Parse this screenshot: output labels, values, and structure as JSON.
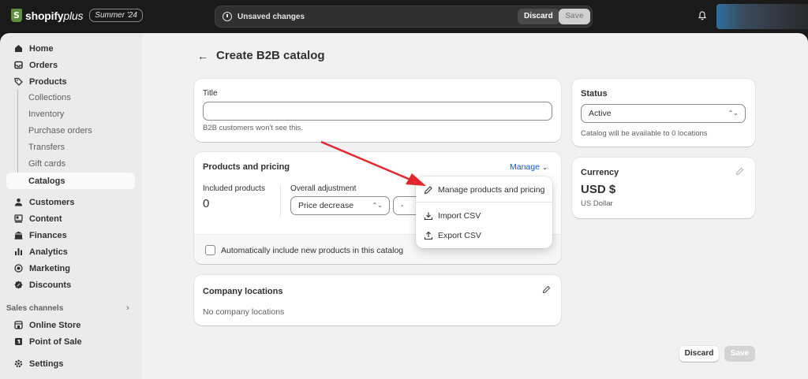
{
  "topbar": {
    "brand": "shopify",
    "brand_plus": "plus",
    "edition": "Summer '24",
    "unsaved_text": "Unsaved changes",
    "discard_label": "Discard",
    "save_label": "Save"
  },
  "sidebar": {
    "items": [
      {
        "label": "Home",
        "icon": "home-icon"
      },
      {
        "label": "Orders",
        "icon": "inbox-icon"
      },
      {
        "label": "Products",
        "icon": "tag-icon"
      },
      {
        "label": "Customers",
        "icon": "person-icon"
      },
      {
        "label": "Content",
        "icon": "content-icon"
      },
      {
        "label": "Finances",
        "icon": "bank-icon"
      },
      {
        "label": "Analytics",
        "icon": "bar-chart-icon"
      },
      {
        "label": "Marketing",
        "icon": "target-icon"
      },
      {
        "label": "Discounts",
        "icon": "discount-icon"
      }
    ],
    "product_subitems": [
      "Collections",
      "Inventory",
      "Purchase orders",
      "Transfers",
      "Gift cards",
      "Catalogs"
    ],
    "sales_channels_label": "Sales channels",
    "channels": [
      {
        "label": "Online Store",
        "icon": "store-icon"
      },
      {
        "label": "Point of Sale",
        "icon": "pos-icon"
      }
    ],
    "settings_label": "Settings"
  },
  "page": {
    "back_icon": "arrow-left-icon",
    "title": "Create B2B catalog"
  },
  "title_card": {
    "label": "Title",
    "value": "",
    "help": "B2B customers won't see this."
  },
  "products_card": {
    "title": "Products and pricing",
    "manage_label": "Manage",
    "included_label": "Included products",
    "included_value": "0",
    "adjustment_label": "Overall adjustment",
    "adjustment_type": "Price decrease",
    "adjustment_value": "-",
    "auto_include_label": "Automatically include new products in this catalog",
    "auto_include_checked": false
  },
  "manage_menu": {
    "items": [
      {
        "label": "Manage products and pricing",
        "icon": "pencil-icon"
      },
      {
        "label": "Import CSV",
        "icon": "download-icon"
      },
      {
        "label": "Export CSV",
        "icon": "upload-icon"
      }
    ]
  },
  "locations_card": {
    "title": "Company locations",
    "empty_text": "No company locations"
  },
  "status_card": {
    "title": "Status",
    "value": "Active",
    "help": "Catalog will be available to 0 locations"
  },
  "currency_card": {
    "title": "Currency",
    "code": "USD $",
    "name": "US Dollar"
  },
  "footer": {
    "discard_label": "Discard",
    "save_label": "Save"
  },
  "colors": {
    "topbar": "#1a1a1a",
    "sidebar": "#ebebeb",
    "main_bg": "#f1f1f1",
    "annotation_arrow": "#e3262c",
    "brand_green": "#5e8e3e"
  }
}
